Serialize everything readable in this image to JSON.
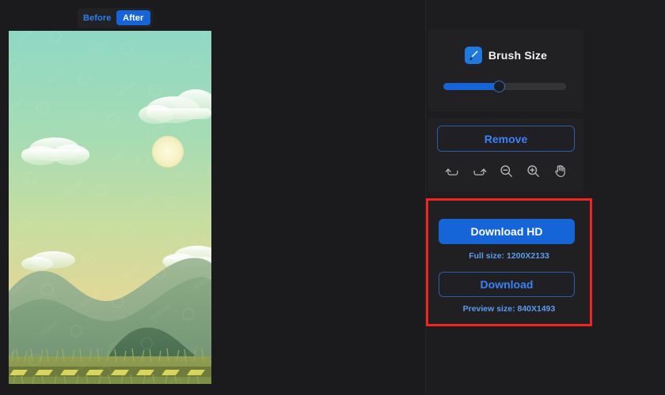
{
  "toggle": {
    "before_label": "Before",
    "after_label": "After",
    "active": "After"
  },
  "brush": {
    "icon": "brush-icon",
    "label": "Brush Size",
    "slider_percent": 46
  },
  "tools": {
    "remove_label": "Remove",
    "icons": [
      {
        "name": "undo-icon",
        "glyph": "undo"
      },
      {
        "name": "redo-icon",
        "glyph": "redo"
      },
      {
        "name": "zoom-out-icon",
        "glyph": "zoom-out"
      },
      {
        "name": "zoom-in-icon",
        "glyph": "zoom-in"
      },
      {
        "name": "hand-tool-icon",
        "glyph": "hand"
      }
    ]
  },
  "download": {
    "hd_label": "Download HD",
    "full_size_label": "Full size: 1200X2133",
    "download_label": "Download",
    "preview_size_label": "Preview size: 840X1493",
    "highlight_color": "#ef2424"
  },
  "colors": {
    "app_background": "#191919",
    "panel_background": "#1d1d1f",
    "card_background": "#212123",
    "accent_blue": "#1565d8",
    "link_blue": "#3b82f6",
    "highlight_red": "#ef2424"
  },
  "preview_image": {
    "name": "landscape-illustration",
    "description": "Sunset landscape with sky gradient, clouds, sun, layered hills, grass and a road",
    "sky_top": "#8fd8c4",
    "sky_mid": "#c8dda0",
    "sky_bottom": "#ecd892",
    "sun_color": "#f7f4cf",
    "hill_back": "#8fae8a",
    "hill_mid": "#7d9e7b",
    "hill_front": "#4f7552",
    "grass_color": "#93a455",
    "road_color": "#6f7b3c",
    "road_dash_color": "#d8d45e"
  }
}
